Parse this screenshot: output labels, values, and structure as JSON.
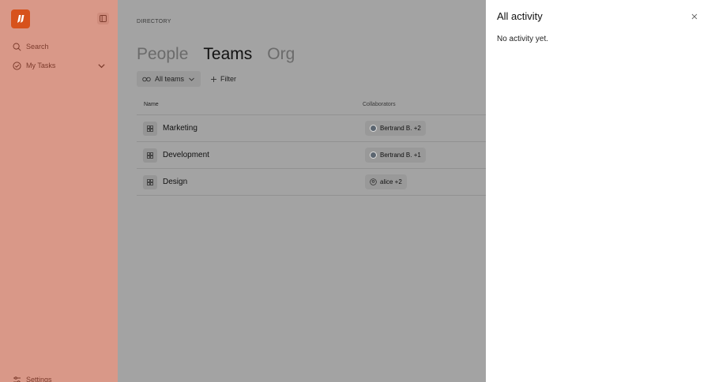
{
  "sidebar": {
    "search_label": "Search",
    "tasks_label": "My Tasks",
    "settings_label": "Settings"
  },
  "main": {
    "breadcrumb": "DIRECTORY",
    "tabs": [
      {
        "label": "People",
        "active": false
      },
      {
        "label": "Teams",
        "active": true
      },
      {
        "label": "Org",
        "active": false
      }
    ],
    "all_teams_label": "All teams",
    "filter_label": "Filter",
    "columns": {
      "name": "Name",
      "collaborators": "Collaborators"
    },
    "rows": [
      {
        "name": "Marketing",
        "collaborators": "Bertrand B. +2",
        "avatar": "photo"
      },
      {
        "name": "Development",
        "collaborators": "Bertrand B. +1",
        "avatar": "photo"
      },
      {
        "name": "Design",
        "collaborators": "alice +2",
        "avatar": "user-circle-icon"
      }
    ]
  },
  "panel": {
    "title": "All activity",
    "empty_text": "No activity yet."
  },
  "colors": {
    "brand": "#d7521c",
    "sidebar_bg_dimmed": "#d99888",
    "overlay": "#a3a3a3"
  }
}
